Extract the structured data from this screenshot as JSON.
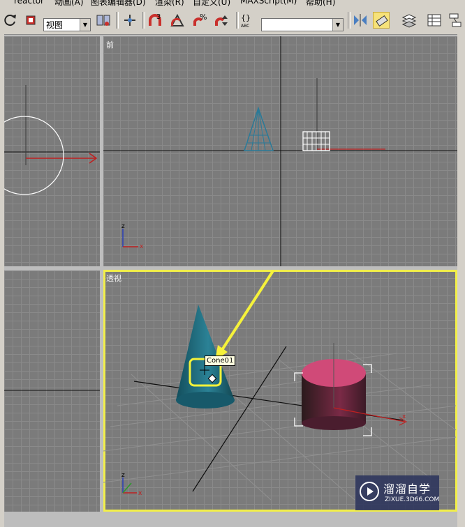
{
  "menu": {
    "items": [
      "reactor",
      "动画(A)",
      "图表编辑器(D)",
      "渲染(R)",
      "自定义(U)",
      "MAXScript(M)",
      "帮助(H)"
    ]
  },
  "toolbar": {
    "view_combo_value": "视图",
    "selection_set_value": "",
    "icons": [
      "redo-icon",
      "select-region-icon",
      "view-dropdown",
      "pivot-icon",
      "manipulate-icon",
      "snap-3-icon",
      "angle-snap-icon",
      "percent-snap-icon",
      "spinner-snap-icon",
      "named-selection-icon",
      "mirror-icon",
      "align-icon",
      "layer-manager-icon",
      "curve-editor-icon",
      "schematic-view-icon"
    ]
  },
  "viewports": {
    "top_left_label": "",
    "front_label": "前",
    "bottom_left_label": "",
    "perspective_label": "透视"
  },
  "axes": {
    "x": "x",
    "y": "y",
    "z": "z"
  },
  "tooltip": "Cone01",
  "watermark": {
    "title": "溜溜自学",
    "subtitle": "ZIXUE.3D66.COM"
  },
  "colors": {
    "viewport_bg": "#7b7b7b",
    "active_border": "#f2ef4a",
    "cone": "#1e6a7a",
    "cylinder": "#c0406c",
    "annotation": "#f5f23a"
  }
}
